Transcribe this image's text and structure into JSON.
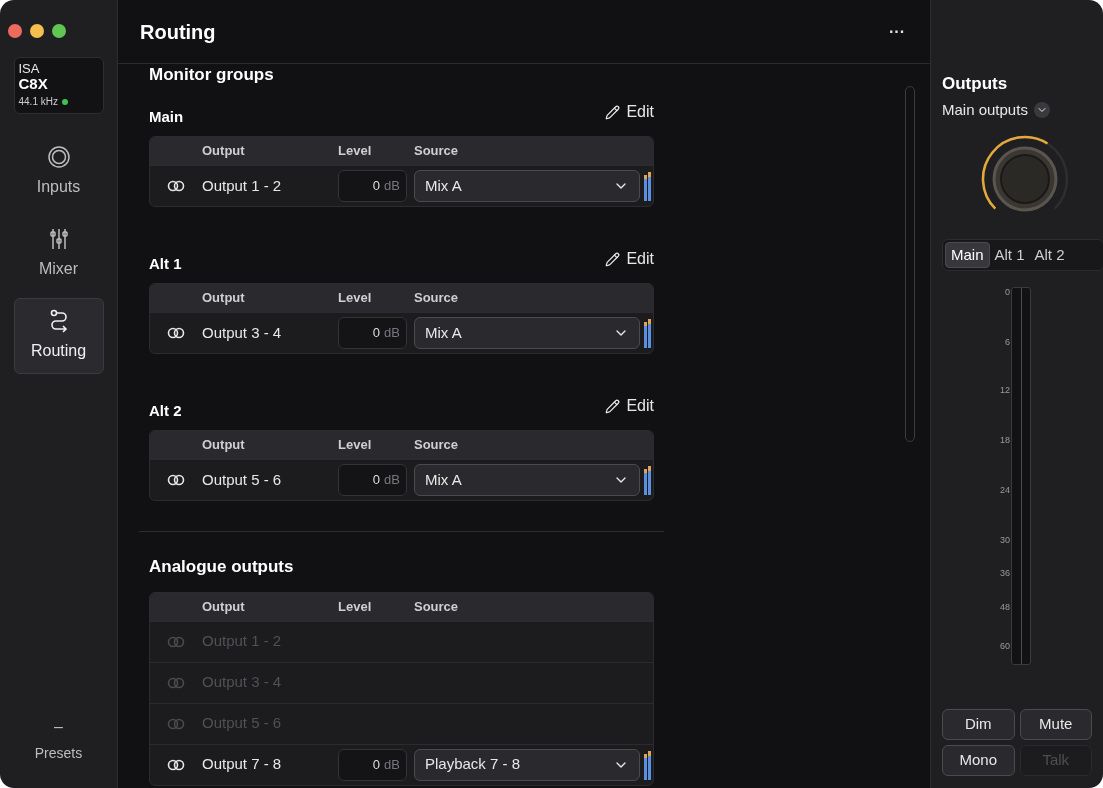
{
  "device": {
    "brand": "ISA",
    "model": "C8X",
    "rate": "44.1 kHz",
    "connected": true
  },
  "nav": [
    {
      "label": "Inputs",
      "kind": "inputs",
      "selected": false
    },
    {
      "label": "Mixer",
      "kind": "mixer",
      "selected": false
    },
    {
      "label": "Routing",
      "kind": "routing",
      "selected": true
    }
  ],
  "presets": {
    "symbol": "–",
    "label": "Presets"
  },
  "header": {
    "title": "Routing",
    "menu": "···"
  },
  "monitor_section": {
    "title": "Monitor groups"
  },
  "groups": [
    {
      "name": "Main",
      "edit": "Edit",
      "columns": [
        "Output",
        "Level",
        "Source"
      ],
      "rows": [
        {
          "output": "Output 1 - 2",
          "level": "0",
          "unit": "dB",
          "source": "Mix A",
          "disabled": false
        }
      ]
    },
    {
      "name": "Alt 1",
      "edit": "Edit",
      "columns": [
        "Output",
        "Level",
        "Source"
      ],
      "rows": [
        {
          "output": "Output 3 - 4",
          "level": "0",
          "unit": "dB",
          "source": "Mix A",
          "disabled": false
        }
      ]
    },
    {
      "name": "Alt 2",
      "edit": "Edit",
      "columns": [
        "Output",
        "Level",
        "Source"
      ],
      "rows": [
        {
          "output": "Output 5 - 6",
          "level": "0",
          "unit": "dB",
          "source": "Mix A",
          "disabled": false
        }
      ]
    }
  ],
  "analogue": {
    "title": "Analogue outputs",
    "columns": [
      "Output",
      "Level",
      "Source"
    ],
    "rows": [
      {
        "output": "Output 1 - 2",
        "disabled": true
      },
      {
        "output": "Output 3 - 4",
        "disabled": true
      },
      {
        "output": "Output 5 - 6",
        "disabled": true
      },
      {
        "output": "Output 7 - 8",
        "level": "0",
        "unit": "dB",
        "source": "Playback 7 - 8",
        "disabled": false
      }
    ]
  },
  "outputs_panel": {
    "title": "Outputs",
    "selector": "Main outputs",
    "tabs": [
      {
        "label": "Main",
        "selected": true
      },
      {
        "label": "Alt 1",
        "selected": false
      },
      {
        "label": "Alt 2",
        "selected": false
      }
    ],
    "scale": [
      "0",
      "6",
      "12",
      "18",
      "24",
      "30",
      "36",
      "48",
      "60"
    ],
    "buttons": [
      {
        "label": "Dim",
        "disabled": false
      },
      {
        "label": "Mute",
        "disabled": false
      },
      {
        "label": "Mono",
        "disabled": false
      },
      {
        "label": "Talk",
        "disabled": true
      }
    ]
  }
}
